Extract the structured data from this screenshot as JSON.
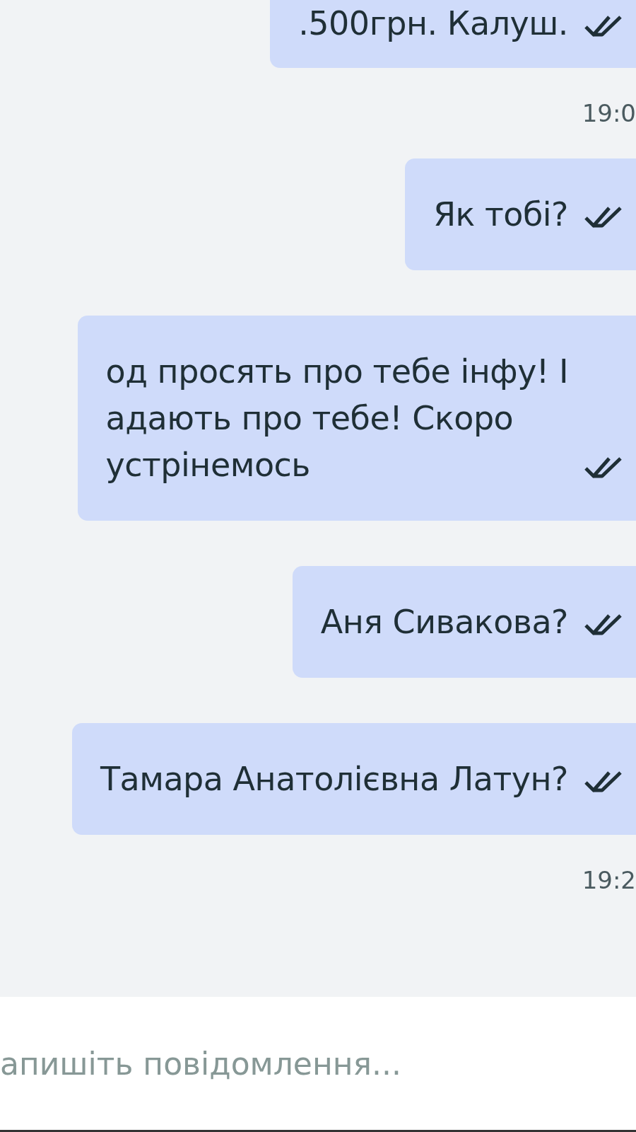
{
  "messages": [
    {
      "kind": "message",
      "text": ".500грн. Калуш.",
      "read": true
    },
    {
      "kind": "time",
      "text": "19:0"
    },
    {
      "kind": "message",
      "text": "Як тобі?",
      "read": true
    },
    {
      "kind": "message",
      "text": "од просять про тебе інфу! І\nадають про тебе! Скоро\nустрінемось",
      "read": true
    },
    {
      "kind": "message",
      "text": "Аня Сивакова?",
      "read": true
    },
    {
      "kind": "message",
      "text": "Тамара Анатолієвна Латун?",
      "read": true
    },
    {
      "kind": "time",
      "text": "19:2"
    }
  ],
  "composer": {
    "placeholder": "апишіть повідомлення..."
  }
}
